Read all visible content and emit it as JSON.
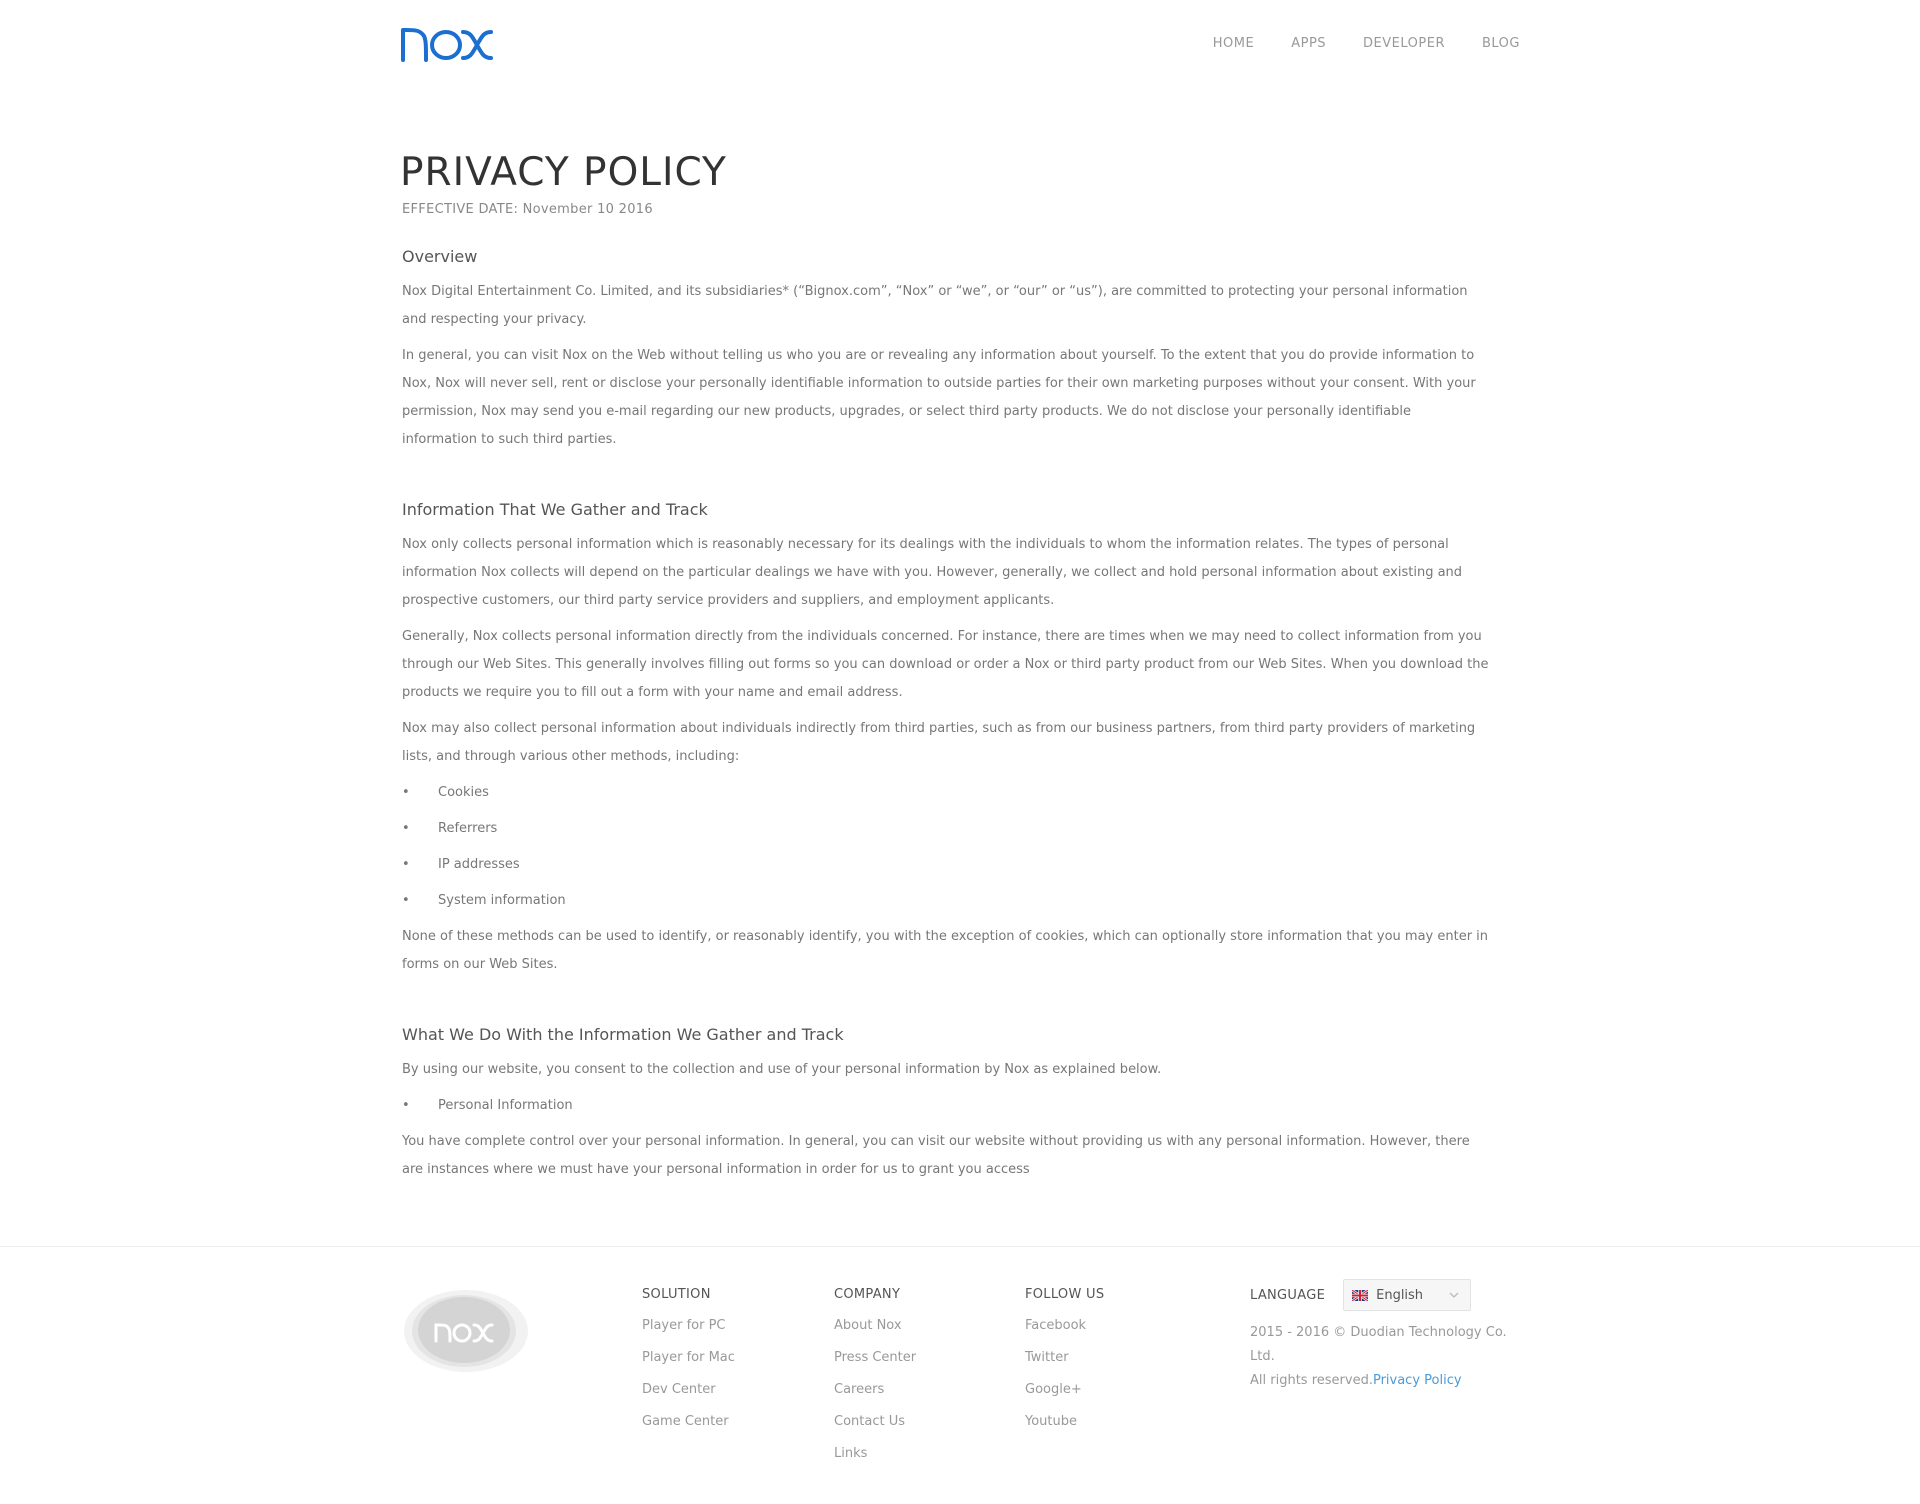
{
  "header": {
    "logo_alt": "nox",
    "nav": [
      {
        "label": "HOME"
      },
      {
        "label": "APPS"
      },
      {
        "label": "DEVELOPER"
      },
      {
        "label": "BLOG"
      }
    ]
  },
  "main": {
    "title": "PRIVACY POLICY",
    "effective_date": "EFFECTIVE DATE: November 10 2016",
    "overview": {
      "heading": "Overview",
      "p1": "Nox Digital Entertainment Co. Limited, and its subsidiaries* (“Bignox.com”, “Nox” or “we”, or “our” or “us”), are committed to protecting your personal information and respecting your privacy.",
      "p2": "In general, you can visit Nox on the Web without telling us who you are or revealing any information about yourself. To the extent that you do provide information to Nox, Nox will never sell, rent or disclose your personally identifiable information to outside parties for their own marketing purposes without your consent. With your permission, Nox may send you e-mail regarding our new products, upgrades, or select third party products. We do not disclose your personally identifiable information to such third parties."
    },
    "gather": {
      "heading": "Information That We Gather and Track",
      "p1": "Nox only collects personal information which is reasonably necessary for its dealings with the individuals to whom the information relates. The types of personal information Nox collects will depend on the particular dealings we have with you.  However, generally, we collect and hold personal information about existing and prospective customers, our third party service providers and suppliers, and employment applicants.",
      "p2": "Generally, Nox collects personal information directly from the individuals concerned.  For instance, there are times when we may need to collect information from you through our Web Sites. This generally involves filling out forms so you can download or order a Nox or third party product from our Web Sites. When you download the products we require you to fill out a form with your name and email address.",
      "p3": "Nox may also collect personal information about individuals indirectly from third parties, such as from our business partners, from third party providers of marketing lists, and through various other methods, including:",
      "bullets": [
        "Cookies",
        "Referrers",
        "IP addresses",
        "System information"
      ],
      "p4": "None of these methods can be used to identify, or reasonably identify, you with the exception of cookies, which can optionally store information that you may enter in forms on our Web Sites."
    },
    "use": {
      "heading": "What We Do With the Information We Gather and Track",
      "p1": "By using our website, you consent to the collection and use of your personal information by Nox as explained below.",
      "bullets": [
        "Personal Information"
      ],
      "p2": "You have complete control over your personal information. In general, you can visit our website without providing us with any personal information. However, there are instances where we must have your personal information in order for us to grant you access"
    }
  },
  "footer": {
    "solution": {
      "heading": "SOLUTION",
      "links": [
        "Player for PC",
        "Player for Mac",
        "Dev Center",
        "Game Center"
      ]
    },
    "company": {
      "heading": "COMPANY",
      "links": [
        "About Nox",
        "Press Center",
        "Careers",
        "Contact Us",
        "Links"
      ]
    },
    "follow": {
      "heading": "FOLLOW US",
      "links": [
        "Facebook",
        "Twitter",
        "Google+",
        "Youtube"
      ]
    },
    "language": {
      "label": "LANGUAGE",
      "selected": "English"
    },
    "copyright_line1": "2015 - 2016 © Duodian Technology Co. Ltd.",
    "copyright_line2": "All rights reserved.",
    "privacy_link": "Privacy Policy"
  },
  "colors": {
    "brand_blue": "#1a6fd0",
    "link_blue": "#4a9ad8"
  }
}
